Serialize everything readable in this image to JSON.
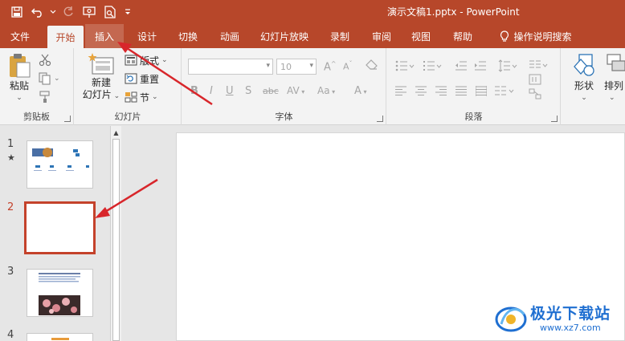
{
  "window": {
    "title": "演示文稿1.pptx  -  PowerPoint"
  },
  "tabs": [
    {
      "label": "文件"
    },
    {
      "label": "开始"
    },
    {
      "label": "插入"
    },
    {
      "label": "设计"
    },
    {
      "label": "切换"
    },
    {
      "label": "动画"
    },
    {
      "label": "幻灯片放映"
    },
    {
      "label": "录制"
    },
    {
      "label": "审阅"
    },
    {
      "label": "视图"
    },
    {
      "label": "帮助"
    },
    {
      "label": "操作说明搜索"
    }
  ],
  "ribbon": {
    "clipboard": {
      "label": "剪贴板",
      "paste": "粘贴"
    },
    "slides": {
      "label": "幻灯片",
      "new_slide_1": "新建",
      "new_slide_2": "幻灯片",
      "layout": "版式",
      "reset": "重置",
      "section": "节"
    },
    "font": {
      "label": "字体",
      "font_size": "10"
    },
    "paragraph": {
      "label": "段落"
    },
    "drawing": {
      "shapes": "形状",
      "arrange": "排列"
    }
  },
  "slides": [
    {
      "num": "1",
      "marker": "★"
    },
    {
      "num": "2"
    },
    {
      "num": "3"
    },
    {
      "num": "4"
    }
  ],
  "watermark": {
    "name": "极光下载站",
    "url": "www.xz7.com"
  },
  "colors": {
    "accent": "#b7472a",
    "selection": "#c4422b",
    "arrow": "#d8262b"
  }
}
